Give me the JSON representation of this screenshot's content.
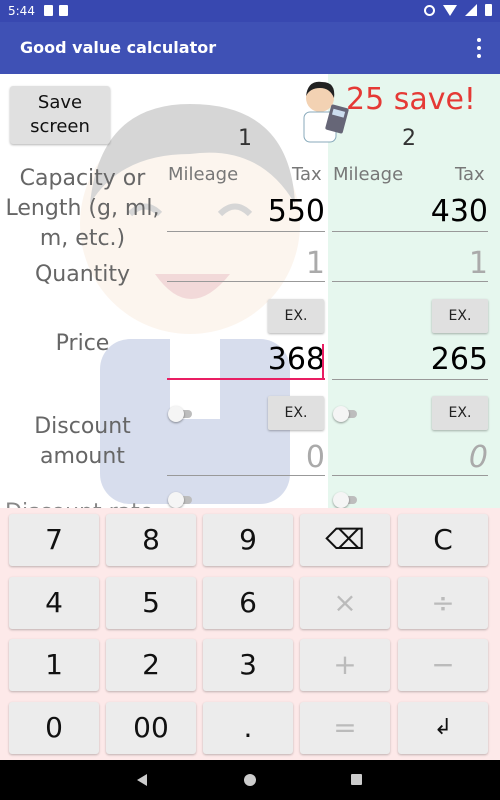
{
  "status_bar": {
    "time": "5:44"
  },
  "app_bar": {
    "title": "Good value calculator"
  },
  "save_screen_button": {
    "line1": "Save",
    "line2": "screen"
  },
  "savings": {
    "text": "25 save!"
  },
  "columns": [
    {
      "number": "1",
      "mileage_label": "Mileage",
      "tax_label": "Tax",
      "capacity": "550",
      "quantity": "1",
      "price": "368",
      "discount": "0",
      "ex_label": "EX."
    },
    {
      "number": "2",
      "mileage_label": "Mileage",
      "tax_label": "Tax",
      "capacity": "430",
      "quantity": "1",
      "price": "265",
      "discount": "0",
      "ex_label": "EX."
    }
  ],
  "labels": {
    "capacity": [
      "Capacity or",
      "Length (g, ml,",
      "m, etc.)"
    ],
    "quantity": "Quantity",
    "price": "Price",
    "discount": [
      "Discount",
      "amount"
    ],
    "discount_rate_partial": "Discount rate"
  },
  "keypad": {
    "rows": [
      [
        "7",
        "8",
        "9",
        "⌫",
        "C"
      ],
      [
        "4",
        "5",
        "6",
        "×",
        "÷"
      ],
      [
        "1",
        "2",
        "3",
        "+",
        "−"
      ],
      [
        "0",
        "00",
        ".",
        "=",
        "↲"
      ]
    ]
  },
  "colors": {
    "app_bar": "#3f51b5",
    "status_bar": "#3848b0",
    "accent": "#e91e63",
    "savings_text": "#e53935",
    "column2_bg": "#e6f7ee",
    "keypad_bg": "#fde9e9"
  }
}
